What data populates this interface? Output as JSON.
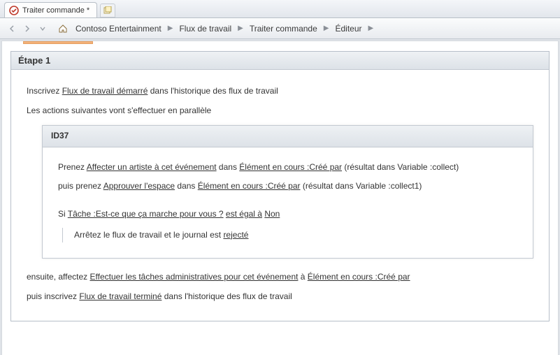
{
  "tab": {
    "title": "Traiter commande *"
  },
  "breadcrumb": {
    "items": [
      "Contoso Entertainment",
      "Flux de travail",
      "Traiter commande",
      "Éditeur"
    ]
  },
  "step": {
    "title": "Étape 1",
    "line1_pre": "Inscrivez ",
    "line1_link": "Flux de travail démarré",
    "line1_post": " dans l'historique des flux de travail",
    "line2": "Les actions suivantes vont s'effectuer en parallèle",
    "inner_title": "ID37",
    "i1_pre": "Prenez ",
    "i1_link1": "Affecter un artiste à cet événement",
    "i1_mid": " dans ",
    "i1_link2": "Élément en cours :Créé par",
    "i1_post": " (résultat dans Variable :collect)",
    "i2_pre": "puis prenez ",
    "i2_link1": "Approuver l'espace",
    "i2_mid": " dans ",
    "i2_link2": "Élément en cours :Créé par",
    "i2_post": " (résultat dans Variable :collect1)",
    "cond_pre": "Si ",
    "cond_link1": "Tâche :Est-ce que ça marche pour vous ?",
    "cond_mid": " ",
    "cond_link2": "est égal à",
    "cond_mid2": " ",
    "cond_link3": "Non",
    "cond_body_pre": "Arrêtez le flux de travail et le journal est ",
    "cond_body_link": "rejecté",
    "after1_pre": "ensuite, affectez ",
    "after1_link1": "Effectuer les tâches administratives pour cet événement",
    "after1_mid": " à ",
    "after1_link2": "Élément en cours :Créé par",
    "after2_pre": "puis inscrivez ",
    "after2_link": "Flux de travail terminé",
    "after2_post": " dans l'historique des flux de travail"
  }
}
